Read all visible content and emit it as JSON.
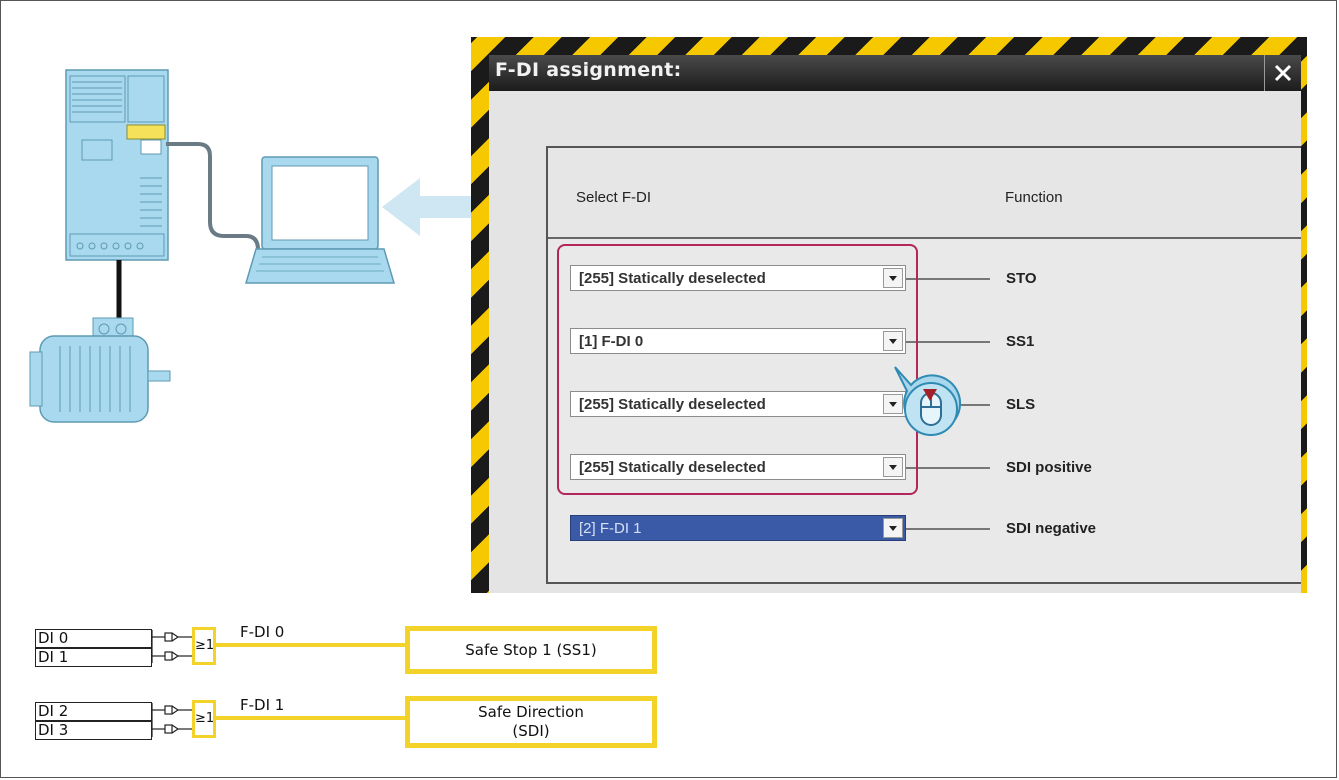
{
  "dialog": {
    "title": "F-DI assignment:",
    "close_icon": "close-icon",
    "columns": {
      "select": "Select F-DI",
      "function": "Function"
    },
    "rows": [
      {
        "value": "[255] Statically deselected",
        "function": "STO",
        "selected": false
      },
      {
        "value": "[1]  F-DI 0",
        "function": "SS1",
        "selected": false
      },
      {
        "value": "[255] Statically deselected",
        "function": "SLS",
        "selected": false
      },
      {
        "value": "[255] Statically deselected",
        "function": "SDI positive",
        "selected": false
      },
      {
        "value": "[2]  F-DI 1",
        "function": "SDI negative",
        "selected": true
      }
    ]
  },
  "logic": {
    "group1": {
      "inputs": [
        "DI 0",
        "DI 1"
      ],
      "gate": "≥1",
      "output": "F-DI 0",
      "target": "Safe Stop 1 (SS1)"
    },
    "group2": {
      "inputs": [
        "DI 2",
        "DI 3"
      ],
      "gate": "≥1",
      "output": "F-DI 1",
      "target_line1": "Safe Direction",
      "target_line2": "(SDI)"
    }
  },
  "colors": {
    "hazard_yellow": "#f6c800",
    "highlight": "#b3265a",
    "selection_blue": "#3a5aa8",
    "device_blue": "#9fd3ea",
    "signal_yellow": "#f3d22a"
  },
  "icons": [
    "converter-icon",
    "motor-icon",
    "laptop-icon",
    "arrow-left-icon",
    "mouse-cursor-icon",
    "close-icon"
  ]
}
